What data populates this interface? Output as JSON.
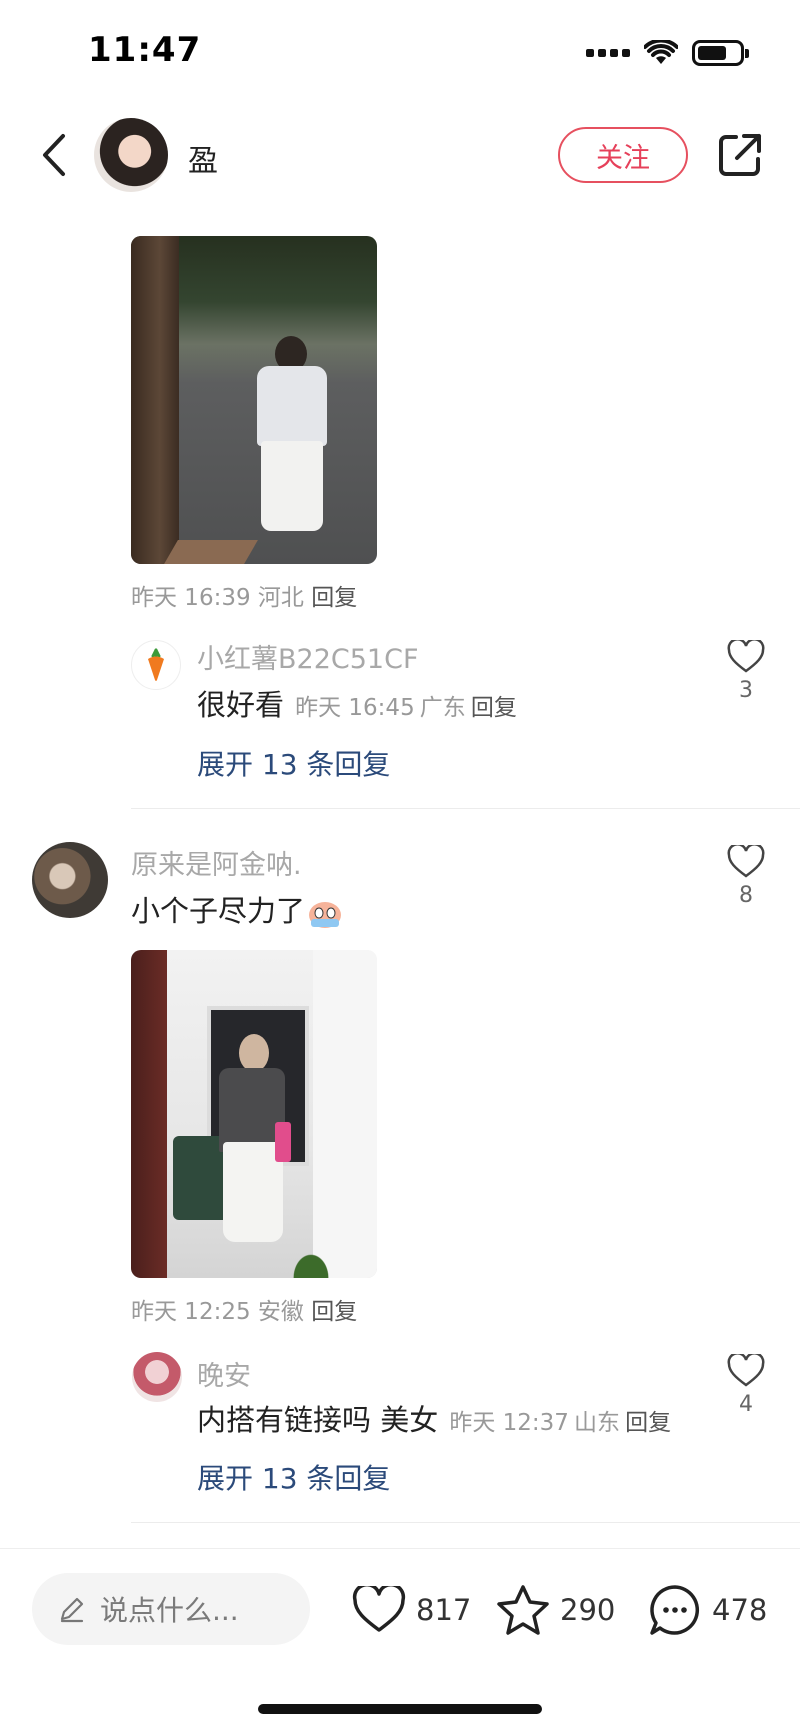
{
  "status_bar": {
    "time": "11:47"
  },
  "header": {
    "username": "盈",
    "follow_label": "关注"
  },
  "comments": [
    {
      "meta_time": "昨天 16:39",
      "meta_location": "河北",
      "reply_label": "回复",
      "reply": {
        "username": "小红薯B22C51CF",
        "content": "很好看",
        "meta_time": "昨天 16:45",
        "meta_location": "广东",
        "reply_label": "回复",
        "likes": "3"
      },
      "expand_label": "展开 13 条回复"
    },
    {
      "username": "原来是阿金呐.",
      "content": "小个子尽力了",
      "likes": "8",
      "meta_time": "昨天 12:25",
      "meta_location": "安徽",
      "reply_label": "回复",
      "reply": {
        "username": "晚安",
        "content": "内搭有链接吗 美女",
        "meta_time": "昨天 12:37",
        "meta_location": "山东",
        "reply_label": "回复",
        "likes": "4"
      },
      "expand_label": "展开 13 条回复"
    }
  ],
  "bottom_bar": {
    "input_placeholder": "说点什么...",
    "like_count": "817",
    "collect_count": "290",
    "comment_count": "478"
  },
  "colors": {
    "accent": "#e6405a",
    "link": "#2b4a7a"
  },
  "icons": [
    "back-icon",
    "share-icon",
    "heart-icon",
    "star-icon",
    "chat-icon",
    "pencil-icon",
    "carrot-icon"
  ]
}
